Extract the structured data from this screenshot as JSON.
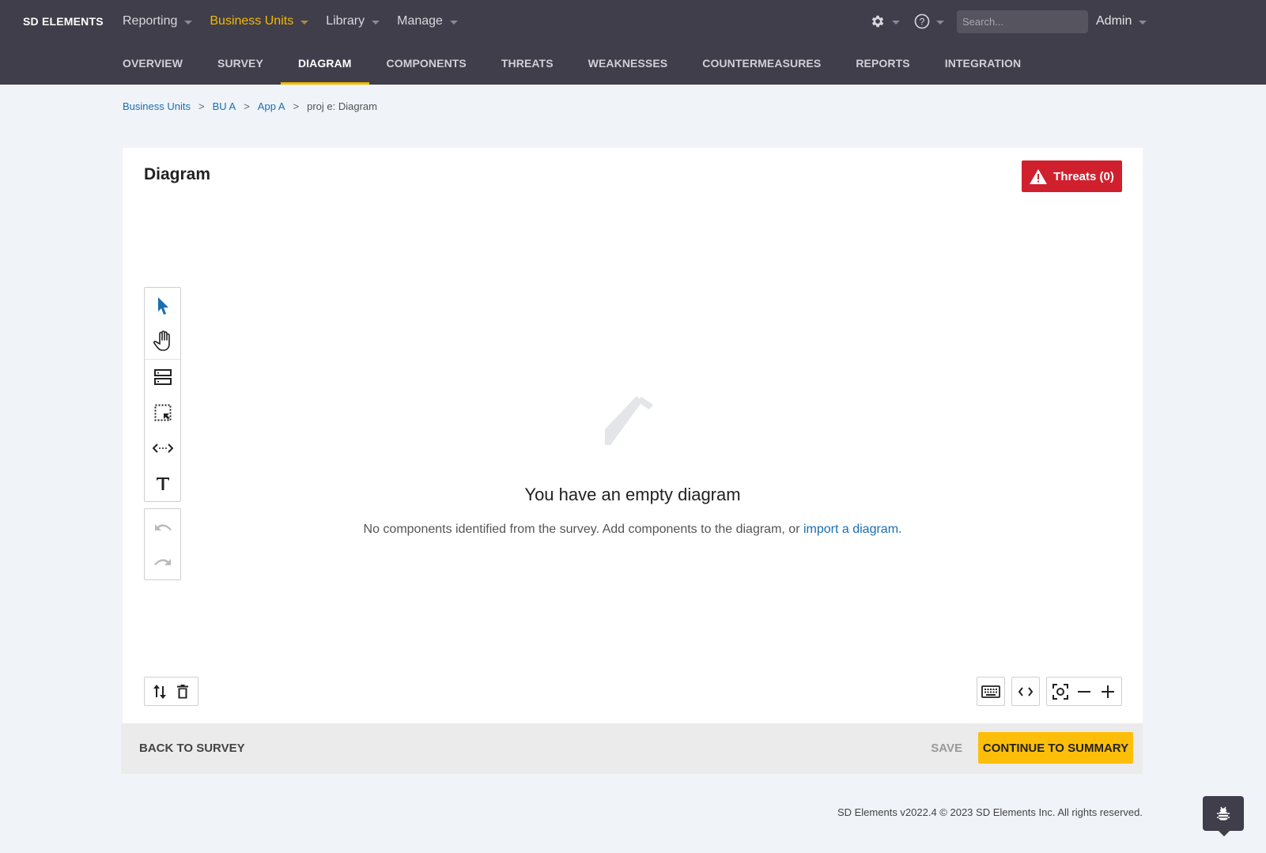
{
  "header": {
    "logo": "SD ELEMENTS",
    "main_nav": [
      {
        "label": "Reporting",
        "active": false
      },
      {
        "label": "Business Units",
        "active": true
      },
      {
        "label": "Library",
        "active": false
      },
      {
        "label": "Manage",
        "active": false
      }
    ],
    "settings_icon": "gear-icon",
    "help_icon": "help-circle-icon",
    "search": {
      "placeholder": "Search...",
      "value": ""
    },
    "user": "Admin"
  },
  "subnav": {
    "tabs": [
      {
        "label": "OVERVIEW",
        "active": false
      },
      {
        "label": "SURVEY",
        "active": false
      },
      {
        "label": "DIAGRAM",
        "active": true
      },
      {
        "label": "COMPONENTS",
        "active": false
      },
      {
        "label": "THREATS",
        "active": false
      },
      {
        "label": "WEAKNESSES",
        "active": false
      },
      {
        "label": "COUNTERMEASURES",
        "active": false
      },
      {
        "label": "REPORTS",
        "active": false
      },
      {
        "label": "INTEGRATION",
        "active": false
      }
    ]
  },
  "breadcrumb": {
    "links": [
      "Business Units",
      "BU A",
      "App A"
    ],
    "separator": ">",
    "current": "proj e: Diagram"
  },
  "diagram": {
    "title": "Diagram",
    "threats_button": "Threats (0)",
    "tools": [
      "select-pointer",
      "pan-hand",
      "add-component",
      "select-area",
      "add-dataflow",
      "add-text"
    ],
    "history_tools": [
      "undo",
      "redo"
    ],
    "empty_title": "You have an empty diagram",
    "empty_desc": "No components identified from the survey. Add components to the diagram, or ",
    "empty_link": "import a diagram",
    "empty_desc_end": ".",
    "bottom_left_tools": [
      "swap-order",
      "delete"
    ],
    "bottom_right_tools": [
      "keyboard-shortcuts",
      "code-view",
      "fit-to-screen",
      "zoom-out",
      "zoom-in"
    ]
  },
  "footer_actions": {
    "back": "BACK TO SURVEY",
    "save": "SAVE",
    "continue": "CONTINUE TO SUMMARY"
  },
  "colors": {
    "accent": "#f5b800",
    "danger": "#d0202e",
    "link": "#1a6fb0",
    "header_bg": "#3f3e4a"
  },
  "copyright": "SD Elements v2022.4 © 2023 SD Elements Inc. All rights reserved."
}
